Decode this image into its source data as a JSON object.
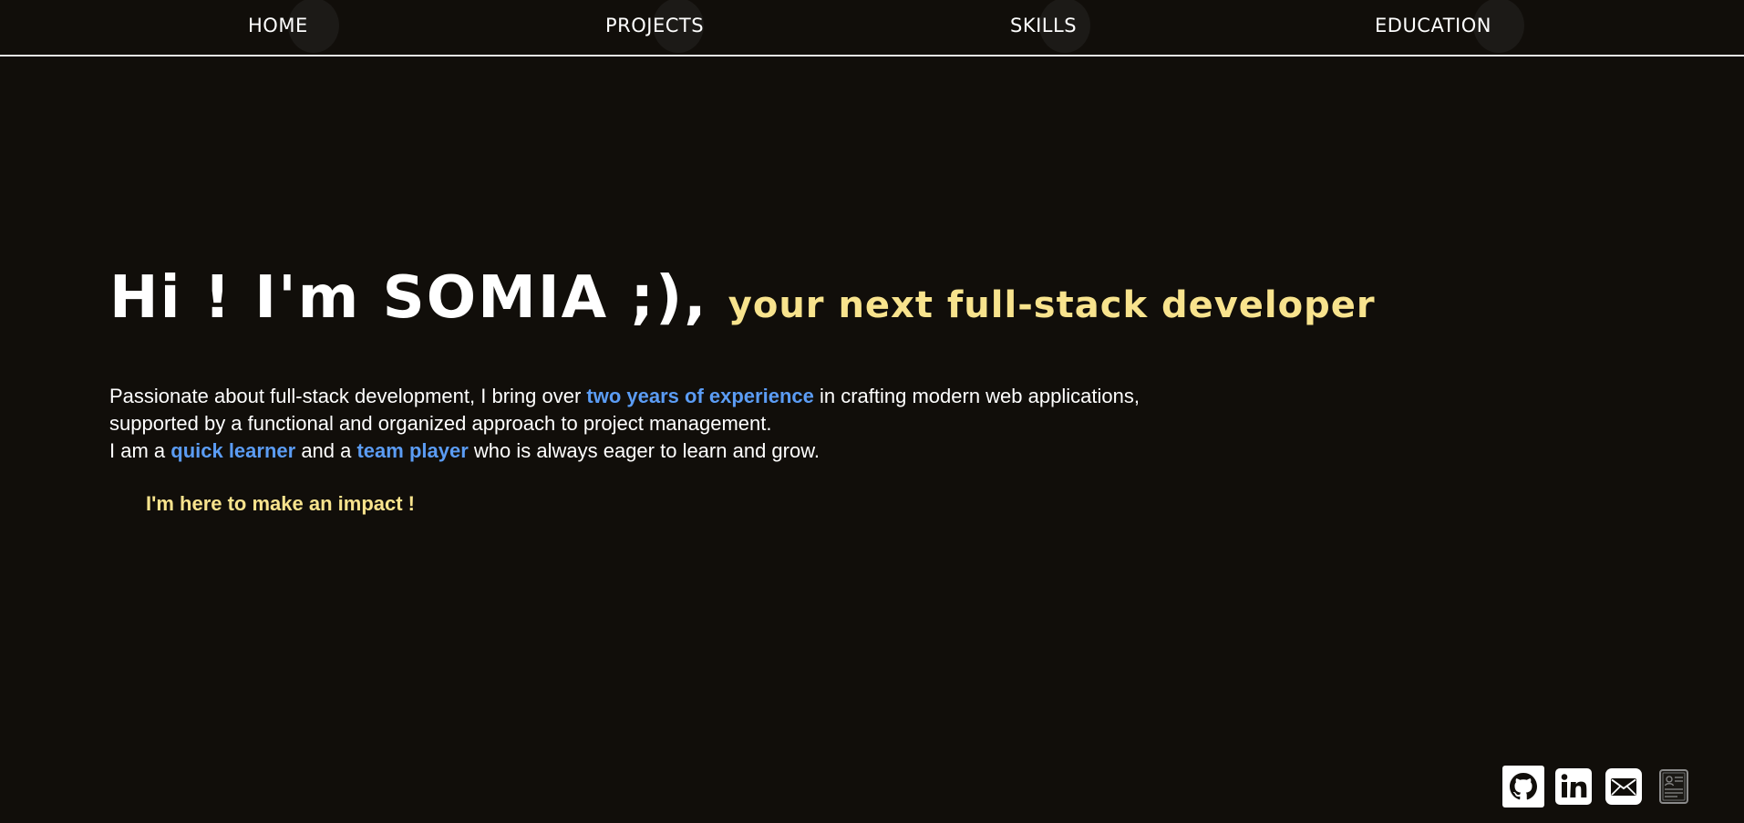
{
  "nav": {
    "items": [
      {
        "label": "HOME"
      },
      {
        "label": "PROJECTS"
      },
      {
        "label": "SKILLS"
      },
      {
        "label": "EDUCATION"
      }
    ]
  },
  "hero": {
    "title": "Hi ! I'm SOMIA ;),",
    "subtitle": "your next full-stack developer"
  },
  "intro": {
    "p1_a": "Passionate about full-stack development, I bring over ",
    "p1_hl": "two years of experience",
    "p1_b": " in crafting modern web applications,",
    "p2": "supported by a functional and organized approach to project management.",
    "p3_a": "I am a ",
    "p3_hl1": "quick learner",
    "p3_b": " and a ",
    "p3_hl2": "team player",
    "p3_c": " who is always eager to learn and grow."
  },
  "impact": "I'm here to make an impact !",
  "socials": {
    "icons": [
      "github-icon",
      "linkedin-icon",
      "mail-icon",
      "resume-icon"
    ]
  },
  "colors": {
    "background": "#110e0a",
    "accent_yellow": "#f8e38d",
    "accent_blue": "#5b9cf4",
    "text": "#ffffff"
  }
}
